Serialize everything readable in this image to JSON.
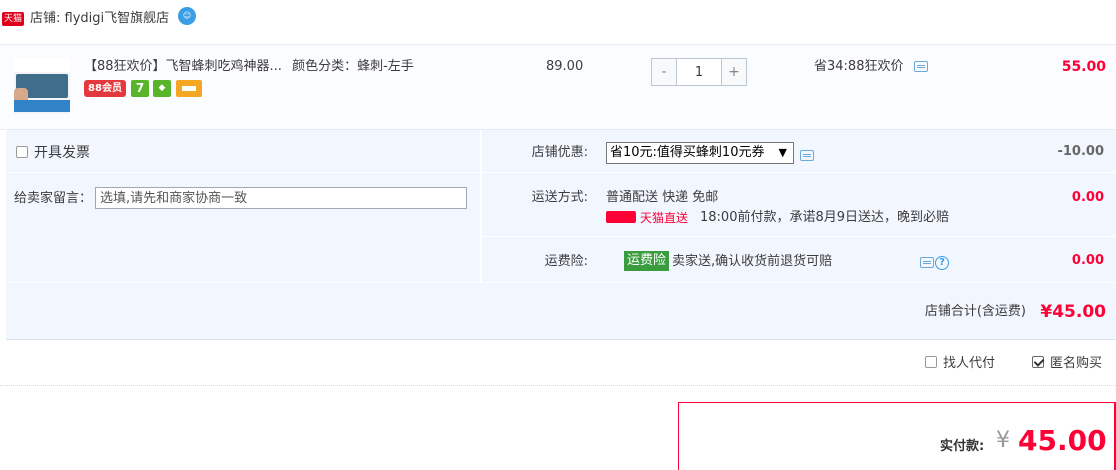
{
  "store": {
    "badge": "天猫",
    "name": "店铺: flydigi飞智旗舰店"
  },
  "item": {
    "title": "【88狂欢价】飞智蜂刺吃鸡神器...",
    "spec": "颜色分类：蜂刺-左手",
    "badge_88": "88会员价",
    "badge_7": "7",
    "price": "89.00",
    "quantity": "1",
    "minus": "-",
    "plus": "+",
    "saving": "省34:88狂欢价",
    "total": "55.00"
  },
  "options": {
    "invoice_label": "开具发票",
    "message_label": "给卖家留言：",
    "message_placeholder": "选填,请先和商家协商一致",
    "coupon_label": "店铺优惠:",
    "coupon_selected": "省10元:值得买蜂刺10元券",
    "coupon_amount": "-10.00",
    "shipping_label": "运送方式:",
    "shipping_method": "普通配送 快递 免邮",
    "tmall_direct": "天猫直送",
    "shipping_promise": "18:00前付款，承诺8月9日送达，晚到必赔",
    "shipping_amount": "0.00",
    "insurance_label": "运费险:",
    "insurance_tag": "运费险",
    "insurance_text": "卖家送,确认收货前退货可赔",
    "insurance_amount": "0.00",
    "subtotal_label": "店铺合计(含运费)",
    "subtotal_amount": "¥45.00"
  },
  "extras": {
    "proxy_label": "找人代付",
    "anon_label": "匿名购买"
  },
  "payment": {
    "label": "实付款:",
    "currency": "¥",
    "amount": "45.00"
  },
  "colors": {
    "accent": "#ff0036",
    "panel": "#f2f7ff",
    "link": "#3a9ee6"
  }
}
